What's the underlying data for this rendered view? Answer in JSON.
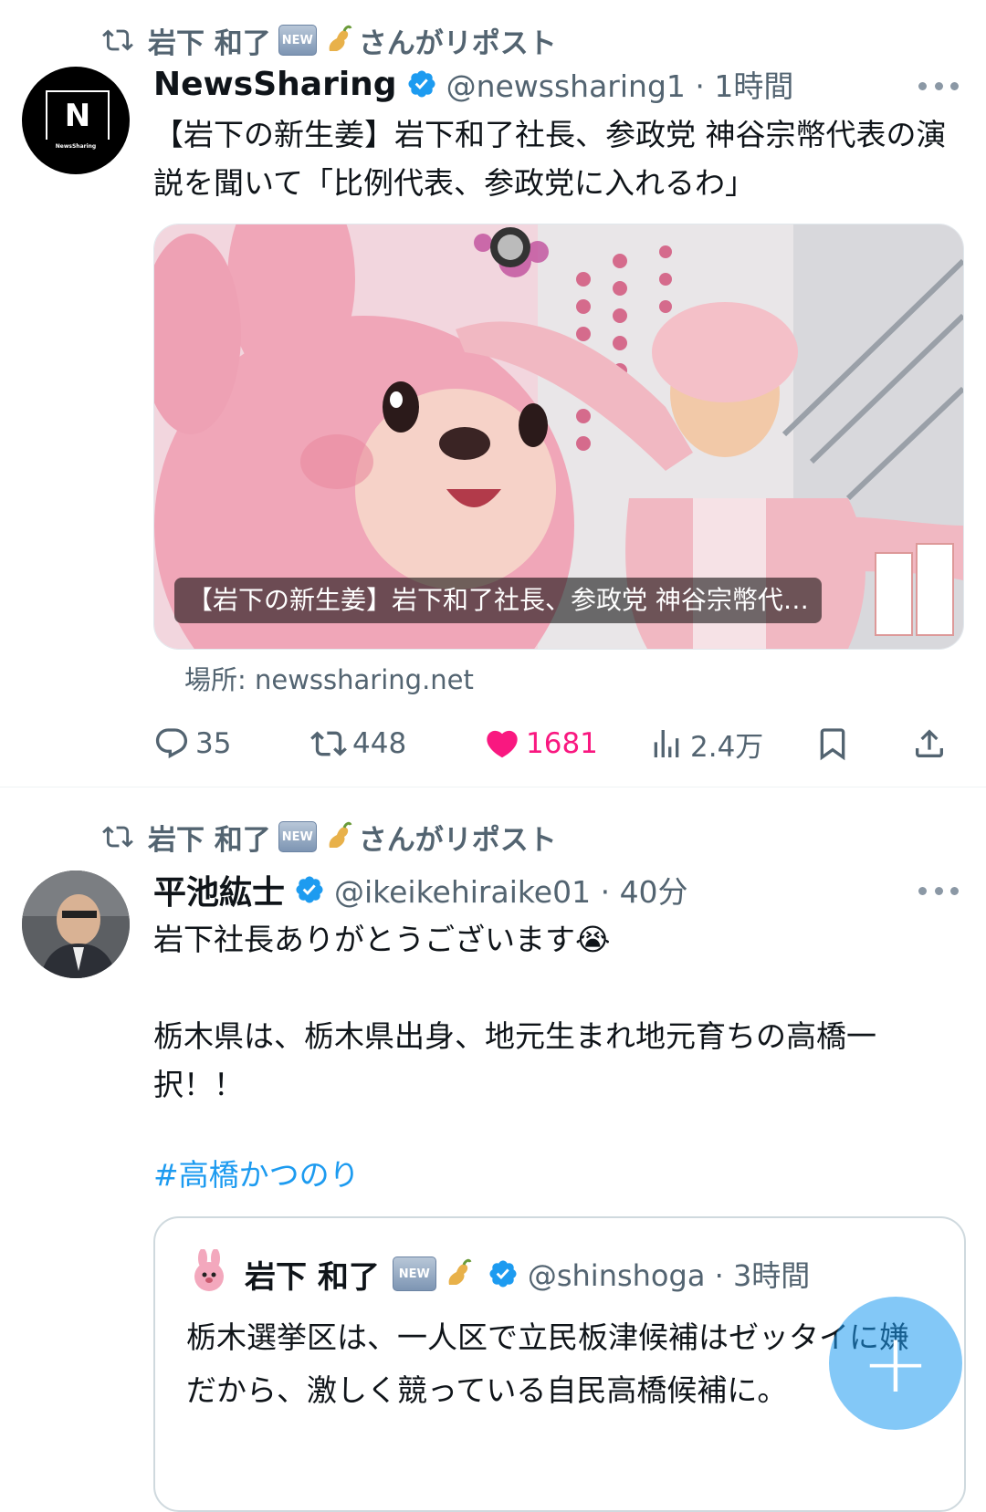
{
  "tweet1": {
    "repost_name": "岩下 和了",
    "repost_badge": "NEW",
    "repost_suffix": "さんがリポスト",
    "avatar_letter": "N",
    "avatar_small": "NewsSharing",
    "display_name": "NewsSharing",
    "handle_time": "@newssharing1 · 1時間",
    "text": "【岩下の新生姜】岩下和了社長、参政党 神谷宗幣代表の演説を聞いて「比例代表、参政党に入れるわ」",
    "card_caption": "【岩下の新生姜】岩下和了社長、参政党 神谷宗幣代…",
    "source": "場所: newssharing.net",
    "replies": "35",
    "reposts": "448",
    "likes": "1681",
    "views": "2.4万"
  },
  "tweet2": {
    "repost_name": "岩下 和了",
    "repost_badge": "NEW",
    "repost_suffix": "さんがリポスト",
    "display_name": "平池紘士",
    "handle_time": "@ikeikehiraike01 · 40分",
    "line1": "岩下社長ありがとうございます😭",
    "line2": "栃木県は、栃木県出身、地元生まれ地元育ちの高橋一択！！",
    "hashtag": "#高橋かつのり",
    "quote": {
      "display_name": "岩下 和了",
      "badge": "NEW",
      "handle_time": "@shinshoga · 3時間",
      "text": "栃木選挙区は、一人区で立民板津候補はゼッタイに嫌だから、激しく競っている自民高橋候補に。"
    }
  },
  "fab_label": "+",
  "colors": {
    "accent": "#1d9bf0",
    "like": "#f91880",
    "muted": "#536471"
  }
}
